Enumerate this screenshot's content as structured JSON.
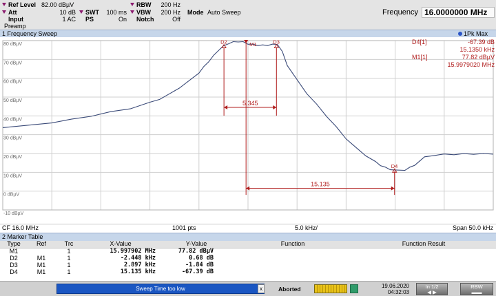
{
  "settings": {
    "ref_level_label": "Ref Level",
    "ref_level_value": "82.00 dBµV",
    "att_label": "Att",
    "att_value": "10 dB",
    "input_label": "Input",
    "input_value": "1 AC",
    "preamp_label": "Preamp",
    "swt_label": "SWT",
    "swt_value": "100 ms",
    "ps_label": "PS",
    "ps_value": "On",
    "rbw_label": "RBW",
    "rbw_value": "200 Hz",
    "vbw_label": "VBW",
    "vbw_value": "200 Hz",
    "mode_label": "Mode",
    "mode_value": "Auto Sweep",
    "notch_label": "Notch",
    "notch_value": "Off",
    "frequency_label": "Frequency",
    "frequency_value": "16.0000000 MHz"
  },
  "sweep_panel": {
    "title": "1 Frequency Sweep",
    "trace_indicator": "1Pk Max",
    "marker_info": [
      {
        "name": "D4[1]",
        "value1": "-67.39 dB",
        "value2": "15.1350 kHz"
      },
      {
        "name": "M1[1]",
        "value1": "77.82 dBµV",
        "value2": "15.9979020 MHz"
      }
    ]
  },
  "chart_data": {
    "type": "line",
    "y_unit": "dBµV",
    "y_ticks": [
      "80 dBµV",
      "70 dBµV",
      "60 dBµV",
      "50 dBµV",
      "40 dBµV",
      "30 dBµV",
      "20 dBµV",
      "10 dBµV",
      "0 dBµV",
      "-10 dBµV"
    ],
    "ylim": [
      -12,
      80
    ],
    "xlim": [
      -25,
      25
    ],
    "x_unit": "kHz offset from CF",
    "grid": true,
    "series": [
      {
        "x": [
          -25,
          -22,
          -20,
          -18,
          -16,
          -14,
          -12,
          -10,
          -9,
          -8,
          -7,
          -6,
          -5,
          -4.5,
          -4,
          -3.5,
          -3,
          -2.5,
          -2,
          -1.5,
          -1,
          -0.5,
          0,
          0.5,
          1,
          1.5,
          2,
          2.5,
          3,
          3.5,
          4,
          5,
          6,
          7,
          8,
          9,
          10,
          11,
          12,
          13,
          13.5,
          14,
          14.5,
          15,
          16,
          16.5,
          17,
          18,
          19,
          20,
          21,
          22,
          23,
          24,
          25
        ],
        "y": [
          34,
          35,
          36.5,
          38,
          40,
          42,
          44,
          47,
          49,
          51.5,
          55,
          58.5,
          63,
          66,
          69,
          72,
          75,
          77,
          78.5,
          79.2,
          79.5,
          79.2,
          78.3,
          77.9,
          77.6,
          77.5,
          77.6,
          77.9,
          78.2,
          74,
          67,
          59,
          52,
          46,
          40,
          34,
          28,
          23,
          19,
          15.5,
          13.8,
          12.5,
          11.6,
          11,
          11.3,
          12.5,
          14,
          18,
          19.2,
          19.5,
          19.6,
          19.7,
          19.8,
          19.8,
          19.9
        ]
      }
    ],
    "markers": [
      {
        "label": "D2",
        "x": -2.45,
        "y": 76.5
      },
      {
        "label": "M1",
        "x": -0.2,
        "y": 78.9
      },
      {
        "label": "D3",
        "x": 2.9,
        "y": 76.5
      },
      {
        "label": "D4",
        "x": 14.94,
        "y": 10.4
      }
    ],
    "annotations": [
      {
        "label": "5.345",
        "x1": -2.45,
        "x2": 2.9,
        "y": 44.5
      },
      {
        "label": "15.135",
        "x1": -0.2,
        "x2": 14.94,
        "y": 1.5
      }
    ]
  },
  "footer": {
    "cf": "CF 16.0 MHz",
    "points": "1001 pts",
    "div": "5.0 kHz/",
    "span": "Span 50.0 kHz"
  },
  "marker_table": {
    "title": "2 Marker Table",
    "headers": [
      "Type",
      "Ref",
      "Trc",
      "X-Value",
      "Y-Value",
      "Function",
      "Function Result"
    ],
    "rows": [
      {
        "type": "M1",
        "ref": "",
        "trc": "1",
        "x": "15.997902 MHz",
        "y": "77.82 dBµV"
      },
      {
        "type": "D2",
        "ref": "M1",
        "trc": "1",
        "x": "-2.448 kHz",
        "y": "0.68 dB"
      },
      {
        "type": "D3",
        "ref": "M1",
        "trc": "1",
        "x": "2.897 kHz",
        "y": "-1.84 dB"
      },
      {
        "type": "D4",
        "ref": "M1",
        "trc": "1",
        "x": "15.135 kHz",
        "y": "-67.39 dB"
      }
    ]
  },
  "status": {
    "message": "Sweep Time too low",
    "close": "x",
    "state": "Aborted",
    "date": "19.06.2020",
    "time": "04:32:03",
    "page_label": "In 1/2",
    "rbw_btn": "RBW"
  },
  "colors": {
    "trace": "#3a4a78",
    "marker": "#b01c1c",
    "grid": "#cfcfcf",
    "axis_text": "#6a6a6a"
  }
}
